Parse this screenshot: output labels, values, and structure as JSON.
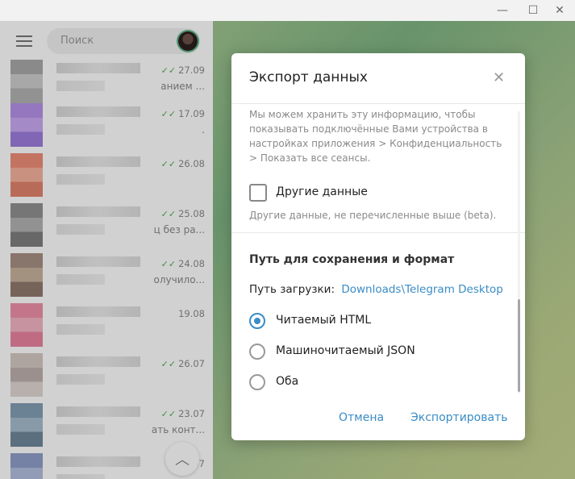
{
  "window": {
    "minimize_glyph": "—",
    "maximize_glyph": "☐",
    "close_glyph": "✕"
  },
  "sidebar": {
    "search_placeholder": "Поиск",
    "chats": [
      {
        "date": "27.09",
        "read": true,
        "preview": "анием ...",
        "avatar_colors": [
          "#8c8c8c",
          "#bdbdbd",
          "#9a9a9a"
        ]
      },
      {
        "date": "17.09",
        "read": true,
        "preview": ".",
        "avatar_colors": [
          "#9c6ee0",
          "#b88cf0",
          "#7c52d0"
        ]
      },
      {
        "date": "26.08",
        "read": true,
        "preview": "",
        "avatar_colors": [
          "#e8694a",
          "#f39a7c",
          "#d85a3c"
        ]
      },
      {
        "date": "25.08",
        "read": true,
        "preview": "ц без ра...",
        "avatar_colors": [
          "#6b6b6b",
          "#999999",
          "#555555"
        ]
      },
      {
        "date": "24.08",
        "read": true,
        "preview": "олучило...",
        "avatar_colors": [
          "#8a6a5a",
          "#b7987e",
          "#6b4e3e"
        ]
      },
      {
        "date": "19.08",
        "read": false,
        "preview": "",
        "avatar_colors": [
          "#e86b8d",
          "#f29bb0",
          "#e25b80"
        ]
      },
      {
        "date": "26.07",
        "read": true,
        "preview": "",
        "avatar_colors": [
          "#c7b5b0",
          "#a89590",
          "#d6c9c5"
        ]
      },
      {
        "date": "23.07",
        "read": true,
        "preview": "ать конт...",
        "avatar_colors": [
          "#5a7e9c",
          "#8aa6bd",
          "#3f6078"
        ]
      },
      {
        "date": "07",
        "read": true,
        "preview": "",
        "avatar_colors": [
          "#6a7fb8",
          "#9aaad4",
          "#4f64a0"
        ]
      }
    ]
  },
  "dialog": {
    "title": "Экспорт данных",
    "info_text": "Мы можем хранить эту информацию, чтобы показывать подключённые Вами устройства в настройках приложения > Конфиденциальность > Показать все сеансы.",
    "other_data_label": "Другие данные",
    "other_data_checked": false,
    "other_data_desc": "Другие данные, не перечисленные выше (beta).",
    "section_title": "Путь для сохранения и формат",
    "path_label": "Путь загрузки:",
    "path_value": "Downloads\\Telegram Desktop",
    "formats": [
      {
        "label": "Читаемый HTML",
        "selected": true
      },
      {
        "label": "Машиночитаемый JSON",
        "selected": false
      },
      {
        "label": "Оба",
        "selected": false
      }
    ],
    "cancel_label": "Отмена",
    "export_label": "Экспортировать"
  },
  "colors": {
    "accent": "#3a8cc5",
    "read_ticks": "#4fae4e"
  }
}
